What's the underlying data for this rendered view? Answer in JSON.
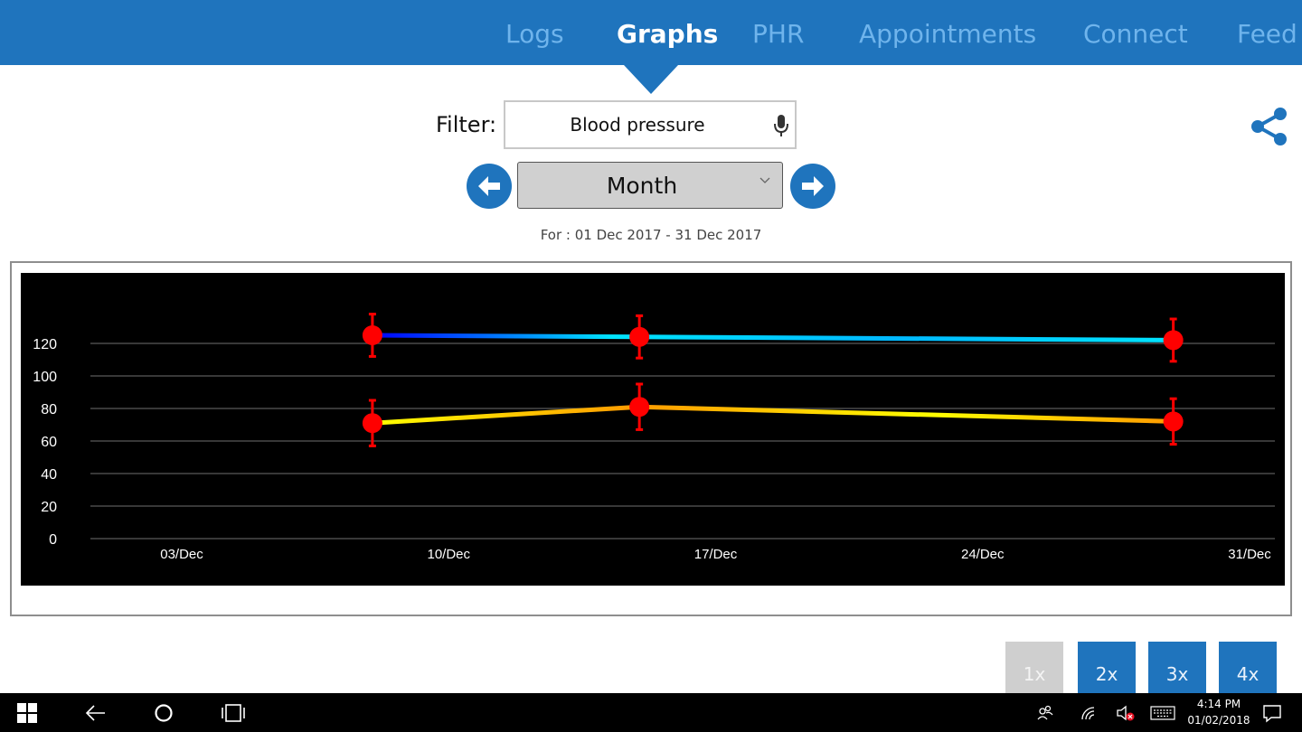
{
  "nav": {
    "tabs": [
      {
        "label": "Logs",
        "active": false
      },
      {
        "label": "Graphs",
        "active": true
      },
      {
        "label": "PHR",
        "active": false
      },
      {
        "label": "Appointments",
        "active": false
      },
      {
        "label": "Connect",
        "active": false
      },
      {
        "label": "Feed",
        "active": false
      }
    ]
  },
  "filter": {
    "label": "Filter:",
    "value": "Blood pressure"
  },
  "period": {
    "selected": "Month",
    "range_text": "For : 01 Dec 2017 - 31 Dec 2017"
  },
  "zoom": {
    "buttons": [
      "1x",
      "2x",
      "3x",
      "4x"
    ],
    "active": "1x"
  },
  "taskbar": {
    "time": "4:14 PM",
    "date": "01/02/2018"
  },
  "colors": {
    "brand": "#1f74bd",
    "point": "#ff0000",
    "systolic_line": [
      "#0000ff",
      "#00e5ff"
    ],
    "diastolic_line": [
      "#ffff00",
      "#ff9a00"
    ]
  },
  "chart_data": {
    "type": "line",
    "x": [
      "08/Dec",
      "15/Dec",
      "29/Dec"
    ],
    "xticks": [
      "03/Dec",
      "10/Dec",
      "17/Dec",
      "24/Dec",
      "31/Dec"
    ],
    "yticks": [
      0,
      20,
      40,
      60,
      80,
      100,
      120
    ],
    "ylim": [
      0,
      120
    ],
    "grid": true,
    "series": [
      {
        "values": [
          125,
          124,
          122
        ],
        "error": [
          13,
          13,
          13
        ]
      },
      {
        "values": [
          71,
          81,
          72
        ],
        "error": [
          14,
          14,
          14
        ]
      }
    ]
  }
}
